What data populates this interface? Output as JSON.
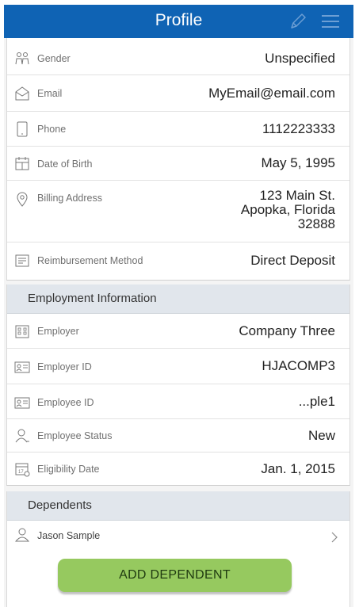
{
  "header": {
    "title": "Profile"
  },
  "profile": {
    "gender_label": "Gender",
    "gender_value": "Unspecified",
    "email_label": "Email",
    "email_value": "MyEmail@email.com",
    "phone_label": "Phone",
    "phone_value": "1112223333",
    "dob_label": "Date of Birth",
    "dob_value": "May 5, 1995",
    "billing_label": "Billing Address",
    "billing_lines": [
      "123 Main St.",
      "Apopka, Florida",
      "32888"
    ],
    "reimb_label": "Reimbursement Method",
    "reimb_value": "Direct Deposit"
  },
  "employment": {
    "title": "Employment Information",
    "employer_label": "Employer",
    "employer_value": "Company Three",
    "employer_id_label": "Employer ID",
    "employer_id_value": "HJACOMP3",
    "employee_id_label": "Employee ID",
    "employee_id_value": "...ple1",
    "status_label": "Employee Status",
    "status_value": "New",
    "eligibility_label": "Eligibility Date",
    "eligibility_value": "Jan. 1, 2015"
  },
  "dependents": {
    "title": "Dependents",
    "items": [
      {
        "name": "Jason Sample"
      }
    ],
    "add_button": "ADD DEPENDENT"
  },
  "colors": {
    "header": "#0f63b4",
    "button": "#96c95f",
    "section_bg": "#e1e6ec"
  },
  "icons": [
    "pencil-icon",
    "menu-icon",
    "gender-icon",
    "email-icon",
    "phone-icon",
    "calendar-icon",
    "location-pin-icon",
    "reimbursement-icon",
    "building-icon",
    "id-card-icon",
    "user-icon",
    "eligibility-calendar-icon",
    "chevron-right-icon"
  ]
}
